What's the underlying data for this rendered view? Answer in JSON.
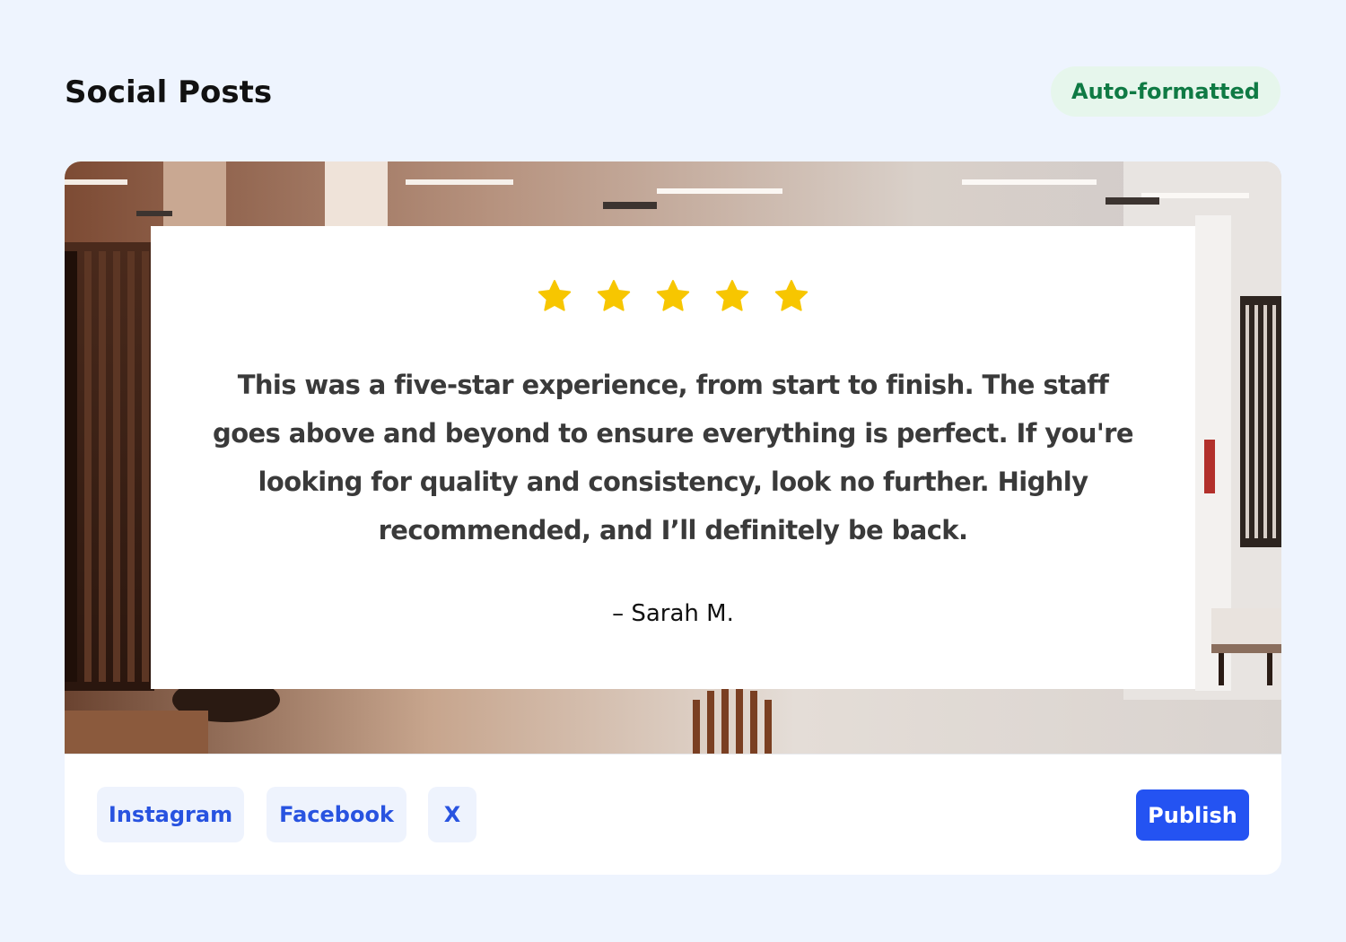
{
  "header": {
    "title": "Social Posts",
    "badge": "Auto-formatted"
  },
  "post": {
    "rating": 5,
    "star_icon": "star-icon",
    "quote": "This was a five-star experience, from start to finish. The staff goes above and beyond to ensure everything is perfect. If you're looking for quality and consistency, look no further. Highly recommended, and I’ll definitely be back.",
    "author": "– Sarah M."
  },
  "actions": {
    "platforms": [
      "Instagram",
      "Facebook",
      "X"
    ],
    "publish_label": "Publish"
  },
  "colors": {
    "page_background": "#eef4fe",
    "badge_background": "#e6f6ec",
    "badge_text": "#0f7a44",
    "star": "#f7c600",
    "chip_background": "#eef3fd",
    "chip_text": "#2853e0",
    "publish_background": "#2453f2"
  }
}
